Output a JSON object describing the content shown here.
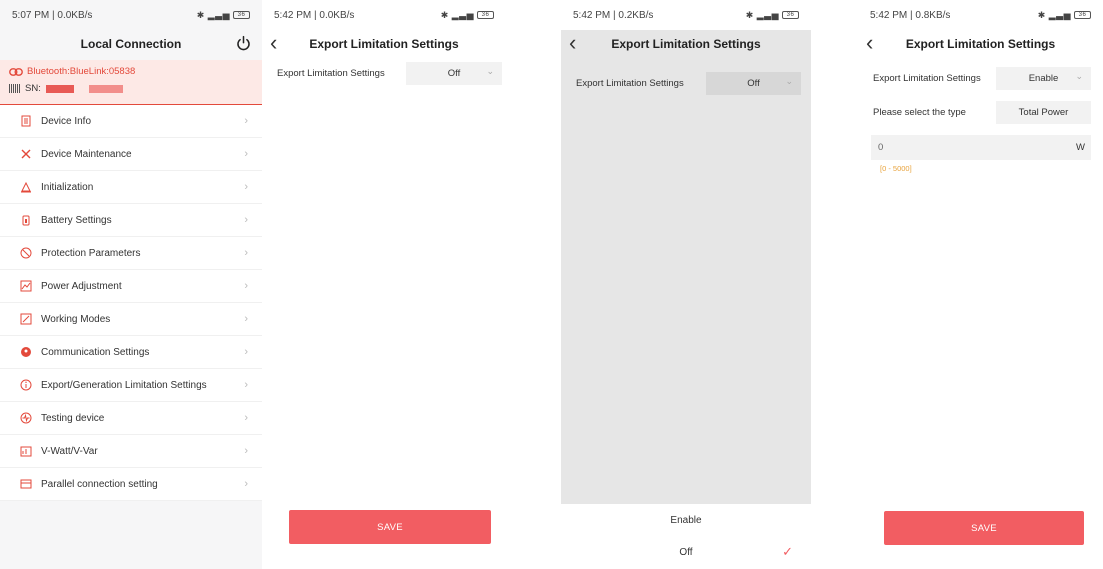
{
  "panel1": {
    "status_time": "5:07 PM | 0.0KB/s",
    "status_right": "4G",
    "battery": "36",
    "title": "Local Connection",
    "bluetooth": "Bluetooth:BlueLink:05838",
    "sn_label": "SN:",
    "menu": [
      {
        "label": "Device Info",
        "icon": "document-icon"
      },
      {
        "label": "Device Maintenance",
        "icon": "tools-icon"
      },
      {
        "label": "Initialization",
        "icon": "initialization-icon"
      },
      {
        "label": "Battery Settings",
        "icon": "battery-icon"
      },
      {
        "label": "Protection Parameters",
        "icon": "prohibition-icon"
      },
      {
        "label": "Power Adjustment",
        "icon": "chart-icon"
      },
      {
        "label": "Working Modes",
        "icon": "mode-icon"
      },
      {
        "label": "Communication Settings",
        "icon": "antenna-icon"
      },
      {
        "label": "Export/Generation Limitation Settings",
        "icon": "info-circle-icon"
      },
      {
        "label": "Testing device",
        "icon": "pulse-icon"
      },
      {
        "label": "V-Watt/V-Var",
        "icon": "graph-icon"
      },
      {
        "label": "Parallel connection setting",
        "icon": "parallel-icon"
      }
    ]
  },
  "panel2": {
    "status_time": "5:42 PM | 0.0KB/s",
    "title": "Export Limitation Settings",
    "setting_label": "Export Limitation Settings",
    "setting_value": "Off",
    "save": "SAVE"
  },
  "panel3": {
    "status_time": "5:42 PM | 0.2KB/s",
    "title": "Export Limitation Settings",
    "setting_label": "Export Limitation Settings",
    "setting_value": "Off",
    "options": [
      "Enable",
      "Off"
    ],
    "selected": "Off"
  },
  "panel4": {
    "status_time": "5:42 PM | 0.8KB/s",
    "title": "Export Limitation Settings",
    "setting_label": "Export Limitation Settings",
    "setting_value": "Enable",
    "type_label": "Please select the type",
    "type_value": "Total Power",
    "power_value": "0",
    "power_unit": "W",
    "range": "[0 - 5000]",
    "save": "SAVE"
  },
  "colors": {
    "accent": "#f25d62",
    "bluetooth": "#e3493b",
    "range": "#e8a33d"
  }
}
